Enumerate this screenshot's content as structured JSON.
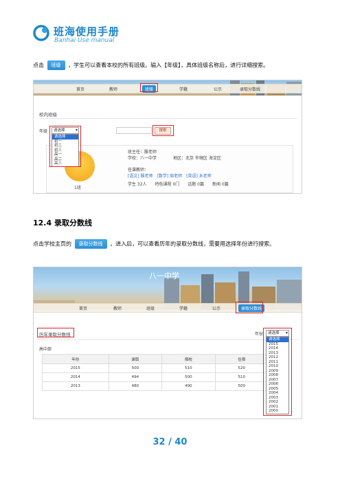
{
  "header": {
    "title": "班海使用手册",
    "subtitle": "Banhai Use manual"
  },
  "para1": {
    "prefix": "点击",
    "button": "班级",
    "suffix": "，学生可以查看本校的所有班级。输入【年级】，具体班级名称后，进行详细搜索。"
  },
  "shot1": {
    "nav": [
      "首页",
      "教师",
      "班级",
      "学籍",
      "公示",
      "录取分数线"
    ],
    "active_nav": "班级",
    "section_title": "校内班级",
    "grade_label": "年级",
    "grade_select": "请选择",
    "grade_options": [
      "请选择",
      "初一",
      "初二",
      "初三",
      "高一",
      "高二",
      "高三"
    ],
    "search_button": "搜索",
    "class_name": "1班",
    "teacher": "班主任：殷老师",
    "school": "学校：八一中学",
    "region": "地区：北京 市辖区 海淀区",
    "subject_teachers_label": "任课教师：",
    "subject_teachers": "[语文] 殷老师　[数学] 周老师　[英语] 未老师",
    "stats": "学生 32人　　特色课程 0门　　话题 0篇　　新闻 0篇"
  },
  "heading": "12.4  录取分数线",
  "para2": {
    "prefix": "点击学校主页的",
    "button": "录取分数线",
    "suffix": "，进入后，可以查看历年的录取分数线，需要用选择年份进行搜索。"
  },
  "shot2": {
    "banner_title": "八一中学",
    "nav": [
      "首页",
      "教师",
      "班级",
      "学籍",
      "公示",
      "录取分数线"
    ],
    "active_nav": "录取分数线",
    "section_title": "历年录取分数线",
    "year_label": "年份",
    "year_select": "请选择",
    "year_options": [
      "请选择",
      "2015",
      "2014",
      "2013",
      "2012",
      "2011",
      "2010",
      "2009",
      "2008",
      "2007",
      "2006",
      "2005",
      "2004",
      "2003",
      "2002",
      "2001",
      "2000"
    ],
    "subsection": "高中部",
    "columns": [
      "年份",
      "录取",
      "择校",
      "住宿"
    ],
    "rows": [
      [
        "2015",
        "500",
        "510",
        "520"
      ],
      [
        "2014",
        "494",
        "500",
        "510"
      ],
      [
        "2013",
        "480",
        "490",
        "500"
      ]
    ]
  },
  "page_number": "32 / 40"
}
